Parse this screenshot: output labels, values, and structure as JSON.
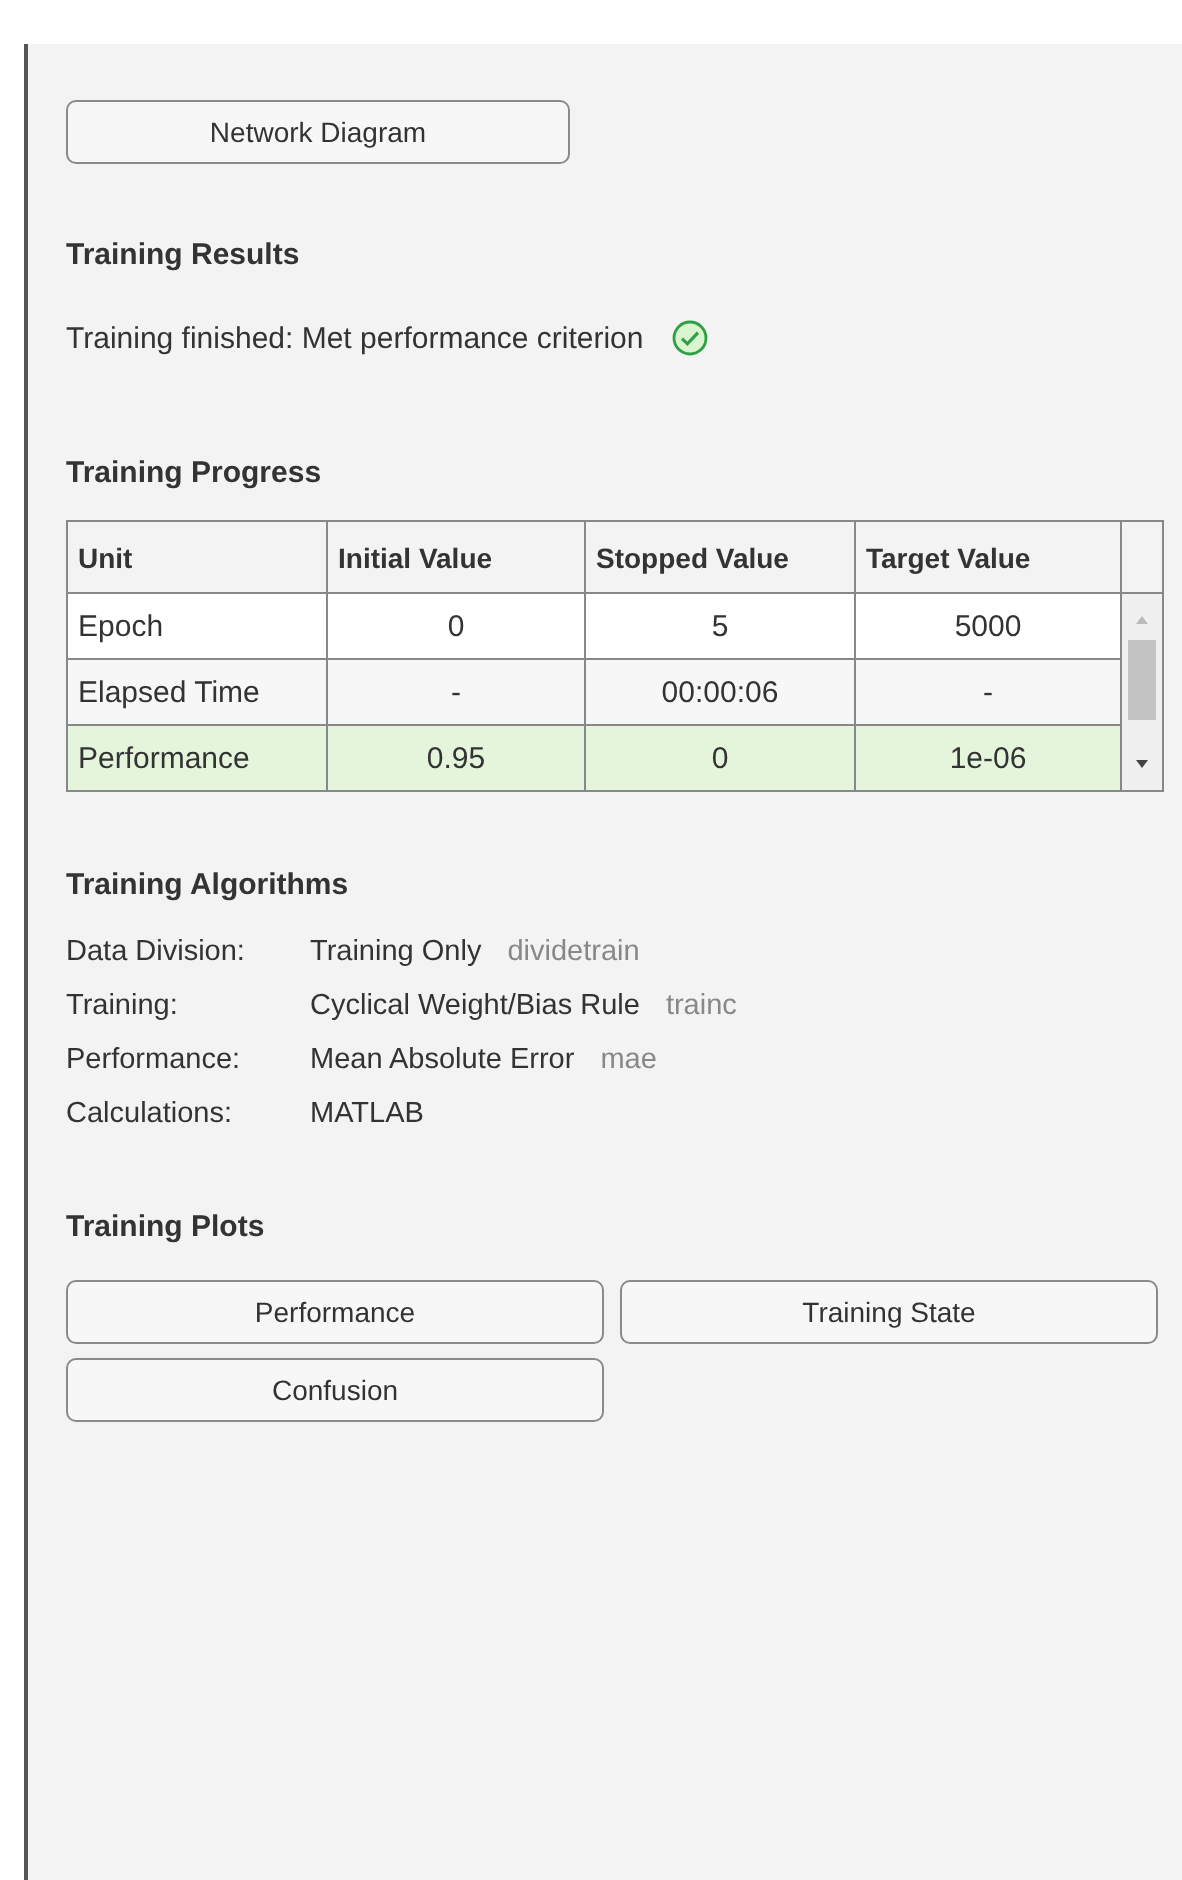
{
  "network_button": "Network Diagram",
  "results": {
    "title": "Training Results",
    "message": "Training finished: Met performance criterion",
    "success": true
  },
  "progress": {
    "title": "Training Progress",
    "columns": [
      "Unit",
      "Initial Value",
      "Stopped Value",
      "Target Value"
    ],
    "rows": [
      {
        "cells": [
          "Epoch",
          "0",
          "5",
          "5000"
        ],
        "met": false
      },
      {
        "cells": [
          "Elapsed Time",
          "-",
          "00:00:06",
          "-"
        ],
        "met": false
      },
      {
        "cells": [
          "Performance",
          "0.95",
          "0",
          "1e-06"
        ],
        "met": true
      }
    ]
  },
  "algorithms": {
    "title": "Training Algorithms",
    "items": [
      {
        "label": "Data Division:",
        "value": "Training Only",
        "function": "dividetrain"
      },
      {
        "label": "Training:",
        "value": "Cyclical Weight/Bias Rule",
        "function": "trainc"
      },
      {
        "label": "Performance:",
        "value": "Mean Absolute Error",
        "function": "mae"
      },
      {
        "label": "Calculations:",
        "value": "MATLAB"
      }
    ]
  },
  "plots": {
    "title": "Training Plots",
    "buttons": [
      "Performance",
      "Training State",
      "Confusion"
    ]
  }
}
